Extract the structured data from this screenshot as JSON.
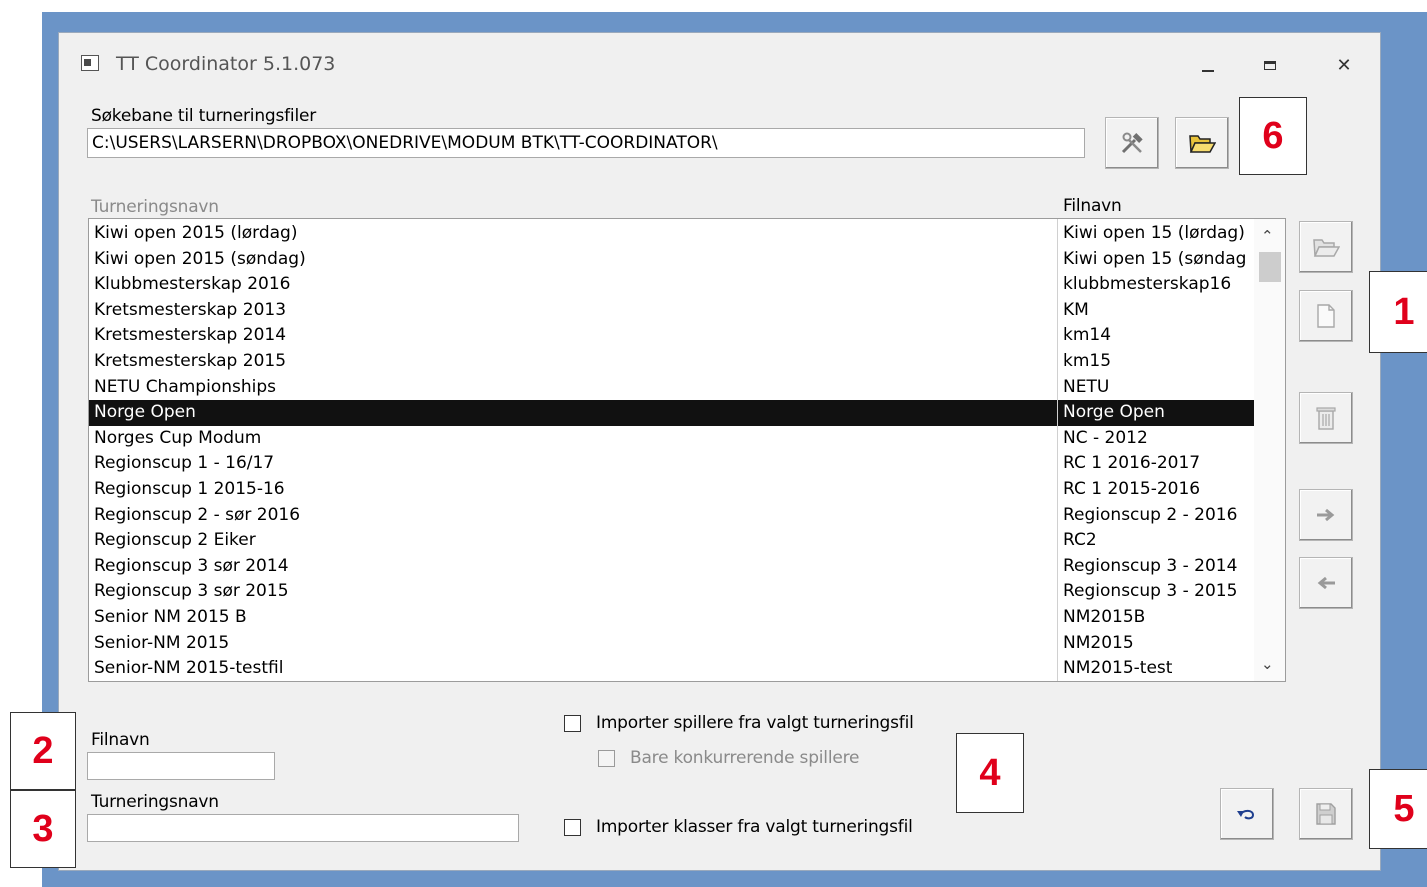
{
  "window": {
    "title": "TT Coordinator 5.1.073"
  },
  "path": {
    "label": "Søkebane til turneringsfiler",
    "value": "C:\\USERS\\LARSERN\\DROPBOX\\ONEDRIVE\\MODUM BTK\\TT-COORDINATOR\\"
  },
  "list": {
    "col_tournament": "Turneringsnavn",
    "col_file": "Filnavn",
    "rows": [
      {
        "name": "Kiwi open 2015 (lørdag)",
        "file": "Kiwi open 15 (lørdag)"
      },
      {
        "name": "Kiwi open 2015 (søndag)",
        "file": "Kiwi open 15 (søndag"
      },
      {
        "name": "Klubbmesterskap 2016",
        "file": "klubbmesterskap16"
      },
      {
        "name": "Kretsmesterskap 2013",
        "file": "KM"
      },
      {
        "name": "Kretsmesterskap 2014",
        "file": "km14"
      },
      {
        "name": "Kretsmesterskap 2015",
        "file": "km15"
      },
      {
        "name": "NETU Championships",
        "file": "NETU"
      },
      {
        "name": "Norge Open",
        "file": "Norge Open"
      },
      {
        "name": "Norges Cup Modum",
        "file": "NC - 2012"
      },
      {
        "name": "Regionscup 1 - 16/17",
        "file": "RC 1 2016-2017"
      },
      {
        "name": "Regionscup 1 2015-16",
        "file": "RC 1 2015-2016"
      },
      {
        "name": "Regionscup 2 - sør 2016",
        "file": "Regionscup 2 - 2016"
      },
      {
        "name": "Regionscup 2 Eiker",
        "file": "RC2"
      },
      {
        "name": "Regionscup 3 sør 2014",
        "file": "Regionscup 3 - 2014"
      },
      {
        "name": "Regionscup 3 sør 2015",
        "file": "Regionscup 3 - 2015"
      },
      {
        "name": "Senior NM 2015 B",
        "file": "NM2015B"
      },
      {
        "name": "Senior-NM 2015",
        "file": "NM2015"
      },
      {
        "name": "Senior-NM 2015-testfil",
        "file": "NM2015-test"
      }
    ]
  },
  "form": {
    "filename_label": "Filnavn",
    "filename_value": "",
    "tournament_label": "Turneringsnavn",
    "tournament_value": "",
    "import_players": "Importer spillere fra valgt turneringsfil",
    "only_competing": "Bare konkurrerende spillere",
    "import_classes": "Importer klasser fra valgt turneringsfil"
  },
  "callouts": {
    "n1": "1",
    "n2": "2",
    "n3": "3",
    "n4": "4",
    "n5": "5",
    "n6": "6"
  },
  "colors": {
    "selection": "#111111",
    "callout": "#e0001b",
    "frame": "#6b94c7"
  }
}
